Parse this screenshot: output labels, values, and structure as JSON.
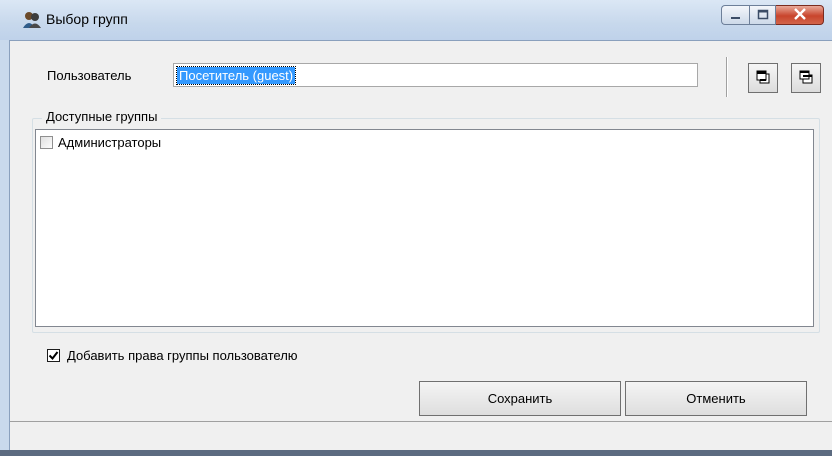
{
  "window": {
    "title": "Выбор групп",
    "app_icon": "users-group-icon"
  },
  "form": {
    "user_label": "Пользователь",
    "user_value": "Посетитель (guest)",
    "toolbar_icons": [
      "copy-window-icon",
      "restore-window-icon"
    ]
  },
  "groups": {
    "title": "Доступные группы",
    "items": [
      {
        "label": "Администраторы",
        "checked": false
      }
    ]
  },
  "options": {
    "add_rights_label": "Добавить права группы пользователю",
    "add_rights_checked": true
  },
  "buttons": {
    "save": "Сохранить",
    "cancel": "Отменить"
  },
  "colors": {
    "selection": "#3399ff",
    "close_button": "#c8452c",
    "dialog_bg": "#f0f0f0"
  }
}
